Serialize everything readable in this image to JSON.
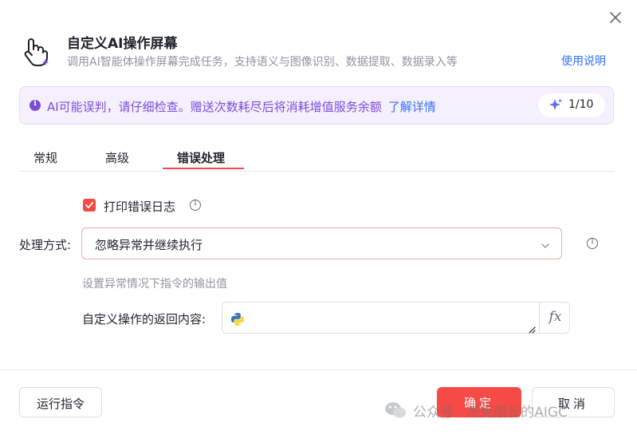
{
  "dialog": {
    "title": "自定义AI操作屏幕",
    "subtitle": "调用AI智能体操作屏幕完成任务，支持语义与图像识别、数据提取、数据录入等",
    "help_link": "使用说明"
  },
  "notice": {
    "text": "AI可能误判，请仔细检查。赠送次数耗尽后将消耗增值服务余额",
    "link": "了解详情",
    "quota": "1/10"
  },
  "tabs": [
    {
      "label": "常规"
    },
    {
      "label": "高级"
    },
    {
      "label": "错误处理",
      "active": true
    }
  ],
  "error_handling": {
    "print_log_label": "打印错误日志",
    "print_log_checked": true,
    "mode_label": "处理方式:",
    "mode_value": "忽略异常并继续执行",
    "hint": "设置异常情况下指令的输出值",
    "return_label": "自定义操作的返回内容:",
    "return_value": "",
    "fx_label": "fx"
  },
  "footer": {
    "run_label": "运行指令",
    "ok_label": "确定",
    "cancel_label": "取消"
  },
  "watermark": {
    "text": "公众号 · 杰克船长的AIGC"
  },
  "colors": {
    "accent": "#f54a45",
    "notice_text": "#7c4ddc",
    "link": "#3370ff"
  }
}
